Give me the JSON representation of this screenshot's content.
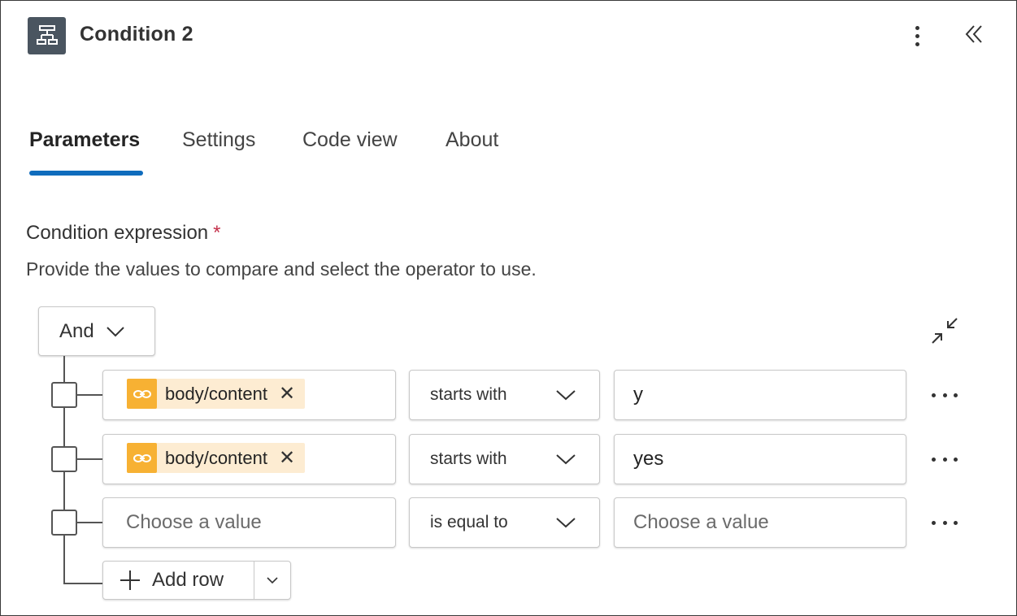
{
  "header": {
    "title": "Condition 2",
    "icon": "condition-icon"
  },
  "tabs": [
    {
      "label": "Parameters",
      "active": true
    },
    {
      "label": "Settings",
      "active": false
    },
    {
      "label": "Code view",
      "active": false
    },
    {
      "label": "About",
      "active": false
    }
  ],
  "condition": {
    "label": "Condition expression",
    "required_mark": "*",
    "description": "Provide the values to compare and select the operator to use.",
    "group_operator": "And",
    "rows": [
      {
        "left_token": "body/content",
        "operator": "starts with",
        "right_value": "y"
      },
      {
        "left_token": "body/content",
        "operator": "starts with",
        "right_value": "yes"
      },
      {
        "left_placeholder": "Choose a value",
        "operator": "is equal to",
        "right_placeholder": "Choose a value"
      }
    ],
    "add_row_label": "Add row"
  },
  "colors": {
    "accent": "#0f6cbd",
    "token_icon": "#f7b133",
    "token_bg": "#fdecd2",
    "node_icon_bg": "#4a5560",
    "required": "#c4314b"
  }
}
